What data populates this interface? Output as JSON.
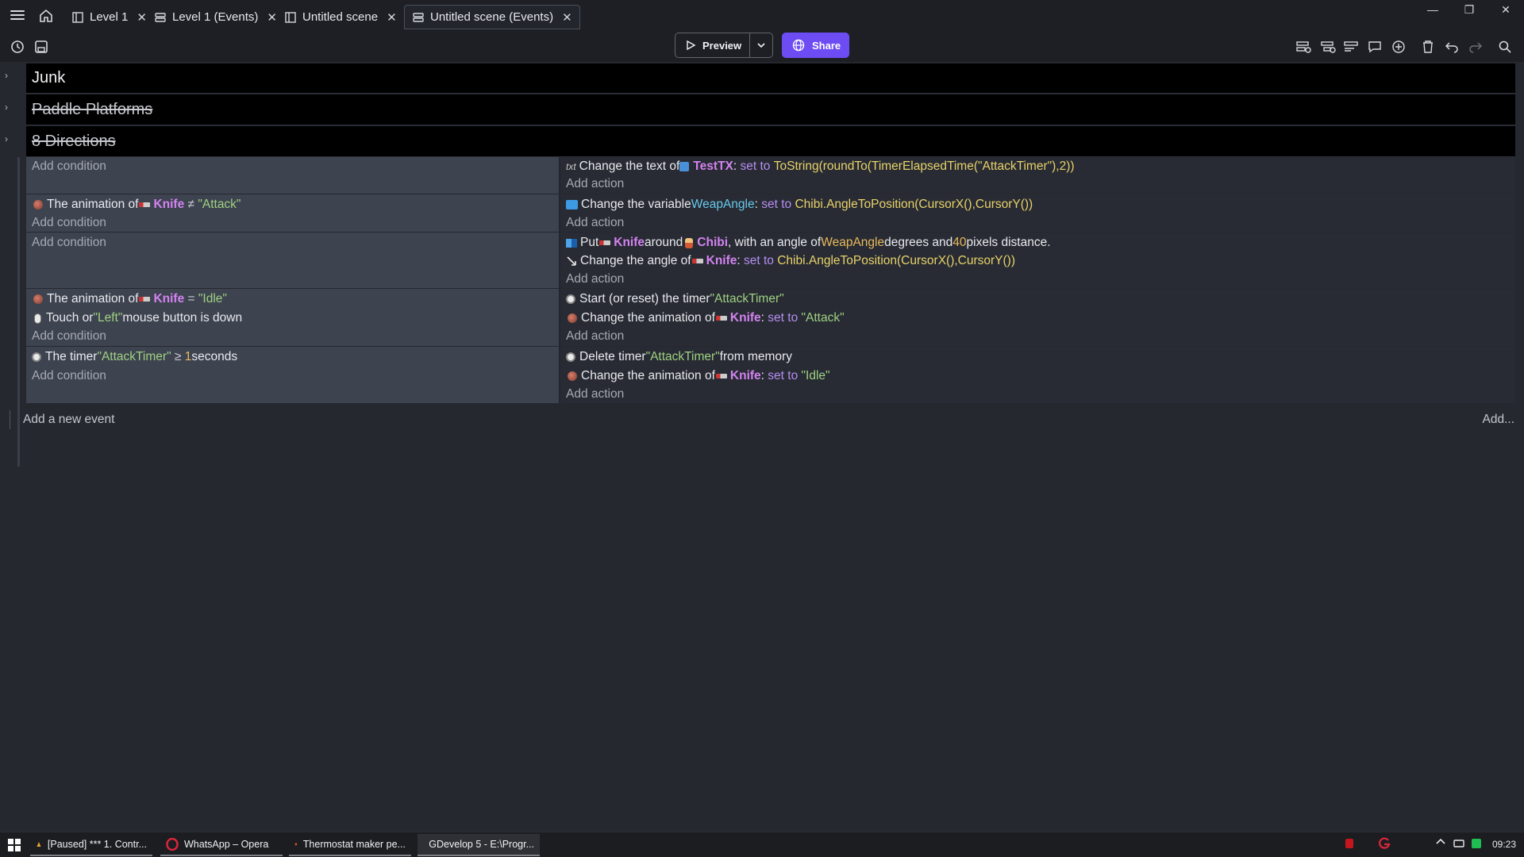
{
  "tabs": [
    {
      "label": "Level 1",
      "icon": "scene-icon"
    },
    {
      "label": "Level 1 (Events)",
      "icon": "events-icon"
    },
    {
      "label": "Untitled scene",
      "icon": "scene-icon"
    },
    {
      "label": "Untitled scene (Events)",
      "icon": "events-icon",
      "active": true
    }
  ],
  "toolbar": {
    "preview_label": "Preview",
    "share_label": "Share"
  },
  "groups": [
    {
      "title": "Junk",
      "disabled": false
    },
    {
      "title": "Paddle Platforms",
      "disabled": true
    },
    {
      "title": "8 Directions",
      "disabled": true
    }
  ],
  "events": [
    {
      "conditions": [],
      "actions": [
        {
          "pre": "Change the text of ",
          "obj": "TestTX",
          "mid": ": ",
          "set": "set to ",
          "expr": "ToString(roundTo(TimerElapsedTime(\"AttackTimer\"),2))"
        }
      ],
      "add_condition": "Add condition",
      "add_action": "Add action"
    },
    {
      "conditions": [
        {
          "pre": "The animation of ",
          "obj": "Knife",
          "op": " ≠ ",
          "str": "\"Attack\""
        }
      ],
      "actions": [
        {
          "pre": "Change the variable ",
          "var": "WeapAngle",
          "mid": ": ",
          "set": "set to ",
          "expr": "Chibi.AngleToPosition(CursorX(),CursorY())"
        }
      ],
      "add_condition": "Add condition",
      "add_action": "Add action"
    },
    {
      "conditions": [],
      "actions": [
        {
          "pre": "Put ",
          "obj": "Knife",
          "mid": " around ",
          "obj2": "Chibi",
          "mid2": ", with an angle of ",
          "varval": "WeapAngle",
          "mid3": " degrees and ",
          "num": "40",
          "post": " pixels distance."
        },
        {
          "pre": "Change the angle of ",
          "obj": "Knife",
          "mid": ": ",
          "set": "set to ",
          "expr": "Chibi.AngleToPosition(CursorX(),CursorY())"
        }
      ],
      "add_condition": "Add condition",
      "add_action": "Add action"
    },
    {
      "conditions": [
        {
          "pre": "The animation of ",
          "obj": "Knife",
          "op": " = ",
          "str": "\"Idle\""
        },
        {
          "pre": "Touch or ",
          "str": "\"Left\"",
          "post": " mouse button is down"
        }
      ],
      "actions": [
        {
          "pre": "Start (or reset) the timer ",
          "str": "\"AttackTimer\""
        },
        {
          "pre": "Change the animation of ",
          "obj": "Knife",
          "mid": ": ",
          "set": "set to ",
          "str": "\"Attack\""
        }
      ],
      "add_condition": "Add condition",
      "add_action": "Add action"
    },
    {
      "conditions": [
        {
          "pre": "The timer ",
          "str": "\"AttackTimer\"",
          "op": " ≥ ",
          "num": "1",
          "post": " seconds"
        }
      ],
      "actions": [
        {
          "pre": "Delete timer ",
          "str": "\"AttackTimer\"",
          "post": " from memory"
        },
        {
          "pre": "Change the animation of ",
          "obj": "Knife",
          "mid": ": ",
          "set": "set to ",
          "str": "\"Idle\""
        }
      ],
      "add_condition": "Add condition",
      "add_action": "Add action"
    }
  ],
  "footer": {
    "add_new_event": "Add a new event",
    "add_more": "Add..."
  },
  "taskbar": {
    "items": [
      {
        "label": "[Paused] *** 1. Contr...",
        "icon": "media-icon"
      },
      {
        "label": "WhatsApp – Opera",
        "icon": "opera-icon"
      },
      {
        "label": "Thermostat maker pe...",
        "icon": "brave-icon"
      },
      {
        "label": "GDevelop 5 - E:\\Progr...",
        "icon": "gdevelop-icon",
        "active": true
      }
    ],
    "clock": "09:23"
  },
  "colors": {
    "accent": "#6d4df3",
    "object": "#d283f0",
    "string": "#9fd182",
    "number": "#e8ba5d",
    "expression": "#e8d26a"
  }
}
